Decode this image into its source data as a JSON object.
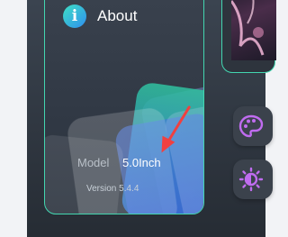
{
  "about": {
    "title": "About",
    "model_label": "Model",
    "model_value": "5.0Inch",
    "version": "Version 5.4.4"
  },
  "side_buttons": [
    {
      "icon": "palette-icon"
    },
    {
      "icon": "brightness-icon"
    }
  ],
  "colors": {
    "accent_border": "#43d6b0",
    "device_bg": "#2b323c",
    "icon_purple": "#c06cf0",
    "arrow_red": "#f04040"
  }
}
